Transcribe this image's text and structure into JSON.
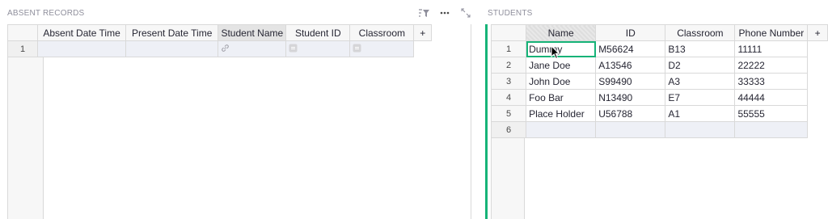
{
  "absent_records": {
    "title": "ABSENT RECORDS",
    "columns": [
      "Absent Date Time",
      "Present Date Time",
      "Student Name",
      "Student ID",
      "Classroom"
    ],
    "add_column": "+",
    "rows": [
      {
        "num": "1"
      }
    ],
    "toolbar": [
      "sort-filter-icon",
      "more-options-icon",
      "expand-icon"
    ]
  },
  "students": {
    "title": "STUDENTS",
    "columns": [
      "Name",
      "ID",
      "Classroom",
      "Phone Number"
    ],
    "add_column": "+",
    "rows": [
      {
        "num": "1",
        "name": "Dummy",
        "id": "M56624",
        "classroom": "B13",
        "phone": "11111"
      },
      {
        "num": "2",
        "name": "Jane Doe",
        "id": "A13546",
        "classroom": "D2",
        "phone": "22222"
      },
      {
        "num": "3",
        "name": "John Doe",
        "id": "S99490",
        "classroom": "A3",
        "phone": "33333"
      },
      {
        "num": "4",
        "name": "Foo Bar",
        "id": "N13490",
        "classroom": "E7",
        "phone": "44444"
      },
      {
        "num": "5",
        "name": "Place Holder",
        "id": "U56788",
        "classroom": "A1",
        "phone": "55555"
      },
      {
        "num": "6",
        "name": "",
        "id": "",
        "classroom": "",
        "phone": ""
      }
    ]
  },
  "colors": {
    "accent": "#16b378",
    "header_bg": "#f7f7f7",
    "grid_line": "#d9d9d9",
    "title": "#8f8f9c"
  }
}
